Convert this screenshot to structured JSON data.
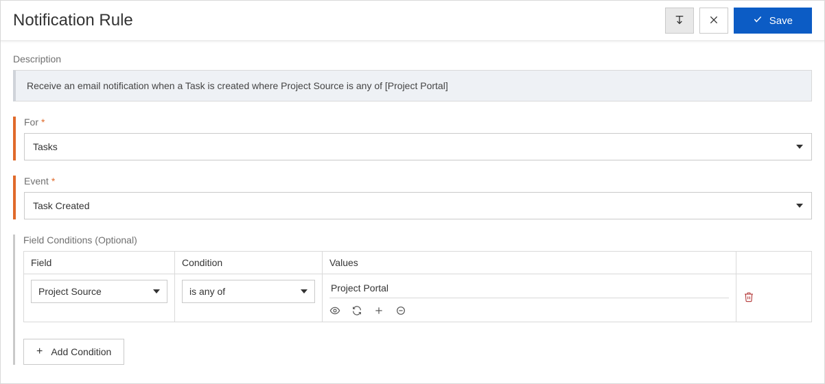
{
  "header": {
    "title": "Notification Rule",
    "save_label": "Save"
  },
  "description": {
    "label": "Description",
    "text": "Receive an email notification when a Task is created where Project Source is any of [Project Portal]"
  },
  "for_field": {
    "label": "For",
    "value": "Tasks"
  },
  "event_field": {
    "label": "Event",
    "value": "Task Created"
  },
  "conditions": {
    "label": "Field Conditions (Optional)",
    "headers": {
      "field": "Field",
      "condition": "Condition",
      "values": "Values"
    },
    "rows": [
      {
        "field": "Project Source",
        "condition": "is any of",
        "value": "Project Portal"
      }
    ],
    "add_label": "Add Condition"
  }
}
